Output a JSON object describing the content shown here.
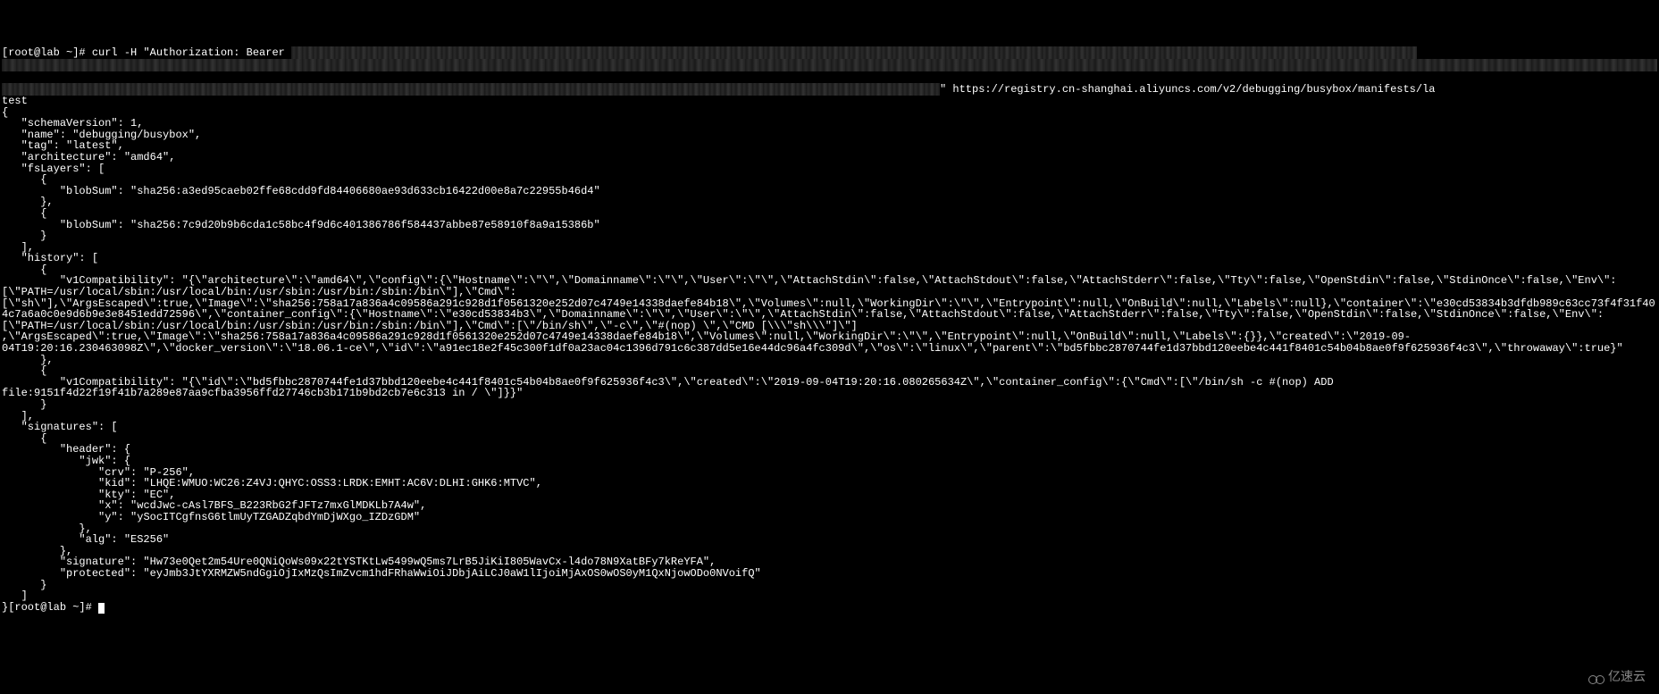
{
  "terminal": {
    "prompt1": "[root@lab ~]# ",
    "command": "curl -H \"Authorization: Bearer ",
    "url_end": "\" https://registry.cn-shanghai.aliyuncs.com/v2/debugging/busybox/manifests/la",
    "test_line": "test",
    "json_open": "{",
    "schema_version": "   \"schemaVersion\": 1,",
    "name": "   \"name\": \"debugging/busybox\",",
    "tag": "   \"tag\": \"latest\",",
    "architecture": "   \"architecture\": \"amd64\",",
    "fslayers_open": "   \"fsLayers\": [",
    "layer1_open": "      {",
    "layer1_blobsum": "         \"blobSum\": \"sha256:a3ed95caeb02ffe68cdd9fd84406680ae93d633cb16422d00e8a7c22955b46d4\"",
    "layer1_close": "      },",
    "layer2_open": "      {",
    "layer2_blobsum": "         \"blobSum\": \"sha256:7c9d20b9b6cda1c58bc4f9d6c401386786f584437abbe87e58910f8a9a15386b\"",
    "layer2_close": "      }",
    "fslayers_close": "   ],",
    "history_open": "   \"history\": [",
    "hist1_open": "      {",
    "hist1_v1compat": "         \"v1Compatibility\": \"{\\\"architecture\\\":\\\"amd64\\\",\\\"config\\\":{\\\"Hostname\\\":\\\"\\\",\\\"Domainname\\\":\\\"\\\",\\\"User\\\":\\\"\\\",\\\"AttachStdin\\\":false,\\\"AttachStdout\\\":false,\\\"AttachStderr\\\":false,\\\"Tty\\\":false,\\\"OpenStdin\\\":false,\\\"StdinOnce\\\":false,\\\"Env\\\":[\\\"PATH=/usr/local/sbin:/usr/local/bin:/usr/sbin:/usr/bin:/sbin:/bin\\\"],\\\"Cmd\\\":[\\\"sh\\\"],\\\"ArgsEscaped\\\":true,\\\"Image\\\":\\\"sha256:758a17a836a4c09586a291c928d1f0561320e252d07c4749e14338daefe84b18\\\",\\\"Volumes\\\":null,\\\"WorkingDir\\\":\\\"\\\",\\\"Entrypoint\\\":null,\\\"OnBuild\\\":null,\\\"Labels\\\":null},\\\"container\\\":\\\"e30cd53834b3dfdb989c63cc73f4f31f404c7a6a0c0e9d6b9e3e8451edd72596\\\",\\\"container_config\\\":{\\\"Hostname\\\":\\\"e30cd53834b3\\\",\\\"Domainname\\\":\\\"\\\",\\\"User\\\":\\\"\\\",\\\"AttachStdin\\\":false,\\\"AttachStdout\\\":false,\\\"AttachStderr\\\":false,\\\"Tty\\\":false,\\\"OpenStdin\\\":false,\\\"StdinOnce\\\":false,\\\"Env\\\":[\\\"PATH=/usr/local/sbin:/usr/local/bin:/usr/sbin:/usr/bin:/sbin:/bin\\\"],\\\"Cmd\\\":[\\\"/bin/sh\\\",\\\"-c\\\",\\\"#(nop) \\\",\\\"CMD [\\\\\\\"sh\\\\\\\"]\\\"] ,\\\"ArgsEscaped\\\":true,\\\"Image\\\":\\\"sha256:758a17a836a4c09586a291c928d1f0561320e252d07c4749e14338daefe84b18\\\",\\\"Volumes\\\":null,\\\"WorkingDir\\\":\\\"\\\",\\\"Entrypoint\\\":null,\\\"OnBuild\\\":null,\\\"Labels\\\":{}},\\\"created\\\":\\\"2019-09-04T19:20:16.230463098Z\\\",\\\"docker_version\\\":\\\"18.06.1-ce\\\",\\\"id\\\":\\\"a91ec18e2f45c300f1df0a23ac04c1396d791c6c387dd5e16e44dc96a4fc309d\\\",\\\"os\\\":\\\"linux\\\",\\\"parent\\\":\\\"bd5fbbc2870744fe1d37bbd120eebe4c441f8401c54b04b8ae0f9f625936f4c3\\\",\\\"throwaway\\\":true}\"",
    "hist1_close": "      },",
    "hist2_open": "      {",
    "hist2_v1compat": "         \"v1Compatibility\": \"{\\\"id\\\":\\\"bd5fbbc2870744fe1d37bbd120eebe4c441f8401c54b04b8ae0f9f625936f4c3\\\",\\\"created\\\":\\\"2019-09-04T19:20:16.080265634Z\\\",\\\"container_config\\\":{\\\"Cmd\\\":[\\\"/bin/sh -c #(nop) ADD file:9151f4d22f19f41b7a289e87aa9cfba3956ffd27746cb3b171b9bd2cb7e6c313 in / \\\"]}}\"",
    "hist2_close": "      }",
    "history_close": "   ],",
    "signatures_open": "   \"signatures\": [",
    "sig_open": "      {",
    "header_open": "         \"header\": {",
    "jwk_open": "            \"jwk\": {",
    "crv": "               \"crv\": \"P-256\",",
    "kid": "               \"kid\": \"LHQE:WMUO:WC26:Z4VJ:QHYC:OSS3:LRDK:EMHT:AC6V:DLHI:GHK6:MTVC\",",
    "kty": "               \"kty\": \"EC\",",
    "x": "               \"x\": \"wcdJwc-cAsl7BFS_B223RbG2fJFTz7mxGlMDKLb7A4w\",",
    "y": "               \"y\": \"ySocITCgfnsG6tlmUyTZGADZqbdYmDjWXgo_IZDzGDM\"",
    "jwk_close": "            },",
    "alg": "            \"alg\": \"ES256\"",
    "header_close": "         },",
    "signature": "         \"signature\": \"Hw73e0Qet2m54Ure0QNiQoWs09x22tYSTKtLw5499wQ5ms7LrB5JiKiI805WavCx-l4do78N9XatBFy7kReYFA\",",
    "protected": "         \"protected\": \"eyJmb3JtYXRMZW5ndGgiOjIxMzQsImZvcm1hdFRhaWwiOiJDbjAiLCJ0aW1lIjoiMjAxOS0wOS0yM1QxNjowODo0NVoifQ\"",
    "sig_close": "      }",
    "signatures_close": "   ]",
    "json_close": "}",
    "prompt2": "[root@lab ~]# "
  },
  "watermark": {
    "text": "亿速云"
  }
}
